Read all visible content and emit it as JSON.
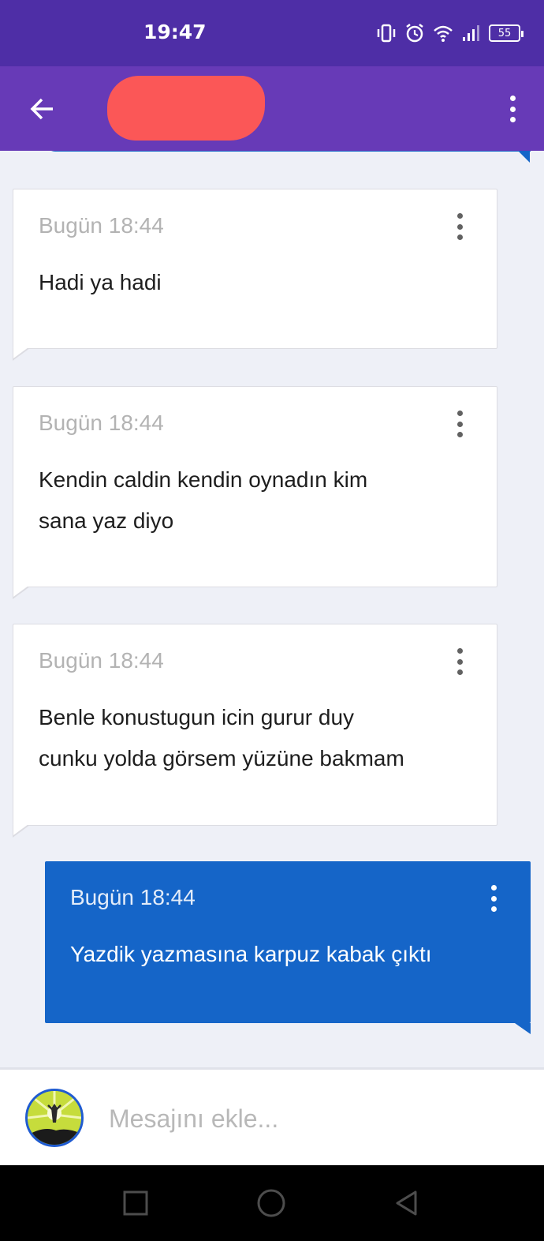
{
  "status_bar": {
    "time": "19:47",
    "battery": "55"
  },
  "app_bar": {
    "title_redacted": true
  },
  "messages": [
    {
      "direction": "incoming",
      "time": "Bugün 18:44",
      "text_lines": [
        "Hadi ya hadi"
      ]
    },
    {
      "direction": "incoming",
      "time": "Bugün 18:44",
      "text_lines": [
        "Kendin caldin kendin oynadın kim",
        "sana yaz diyo"
      ]
    },
    {
      "direction": "incoming",
      "time": "Bugün 18:44",
      "text_lines": [
        "Benle konustugun icin gurur duy",
        "cunku yolda görsem yüzüne bakmam"
      ]
    },
    {
      "direction": "outgoing",
      "time": "Bugün 18:44",
      "text_lines": [
        "Yazdik yazmasına karpuz kabak çıktı"
      ]
    }
  ],
  "composer": {
    "placeholder": "Mesajını ekle..."
  },
  "icons": {
    "back": "arrow-left-icon",
    "more": "more-vert-icon",
    "nav_recents": "square-icon",
    "nav_home": "circle-icon",
    "nav_back": "triangle-back-icon"
  },
  "colors": {
    "status_bar": "#4e2ea6",
    "app_bar": "#673ab7",
    "outgoing_bubble": "#1565c8",
    "background": "#eef0f7"
  }
}
